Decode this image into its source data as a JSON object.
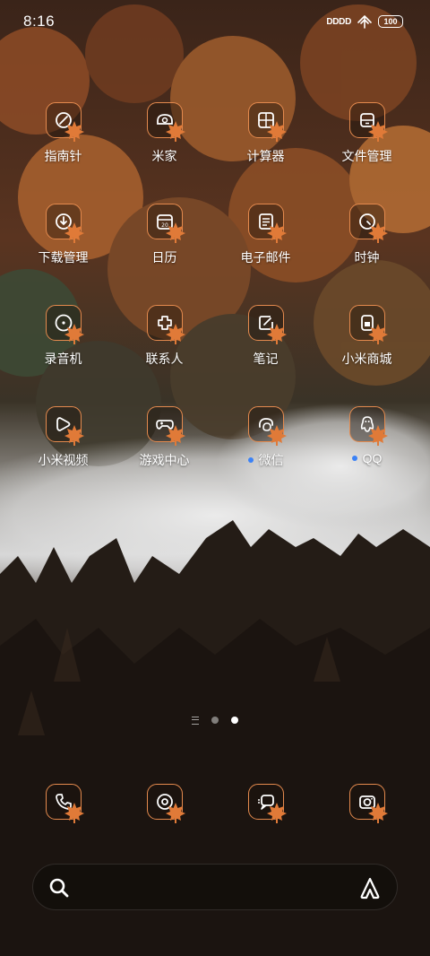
{
  "status_bar": {
    "time": "8:16",
    "signal_text": "DDDD",
    "battery": "100",
    "icons": [
      "signal-icon",
      "wifi-icon",
      "battery-icon"
    ]
  },
  "theme": {
    "icon_outline_color": "#e48a4e",
    "badge_dot_color": "#3b82f6"
  },
  "apps": [
    {
      "label": "指南针",
      "icon": "compass-icon"
    },
    {
      "label": "米家",
      "icon": "mijia-icon"
    },
    {
      "label": "计算器",
      "icon": "calculator-icon"
    },
    {
      "label": "文件管理",
      "icon": "file-manager-icon"
    },
    {
      "label": "下载管理",
      "icon": "download-icon"
    },
    {
      "label": "日历",
      "icon": "calendar-icon"
    },
    {
      "label": "电子邮件",
      "icon": "email-icon"
    },
    {
      "label": "时钟",
      "icon": "clock-icon"
    },
    {
      "label": "录音机",
      "icon": "recorder-icon"
    },
    {
      "label": "联系人",
      "icon": "contacts-icon"
    },
    {
      "label": "笔记",
      "icon": "notes-icon"
    },
    {
      "label": "小米商城",
      "icon": "mi-store-icon"
    },
    {
      "label": "小米视频",
      "icon": "mi-video-icon"
    },
    {
      "label": "游戏中心",
      "icon": "game-center-icon"
    },
    {
      "label": "微信",
      "icon": "wechat-icon",
      "new_badge": true
    },
    {
      "label": "QQ",
      "icon": "qq-icon",
      "new_badge": true
    }
  ],
  "page_indicator": {
    "pages": 2,
    "active": 2
  },
  "dock": [
    {
      "icon": "phone-icon"
    },
    {
      "icon": "browser-icon"
    },
    {
      "icon": "messages-icon"
    },
    {
      "icon": "camera-icon"
    }
  ],
  "search_bar": {
    "icon": "search-icon",
    "assistant_icon": "assistant-icon"
  }
}
